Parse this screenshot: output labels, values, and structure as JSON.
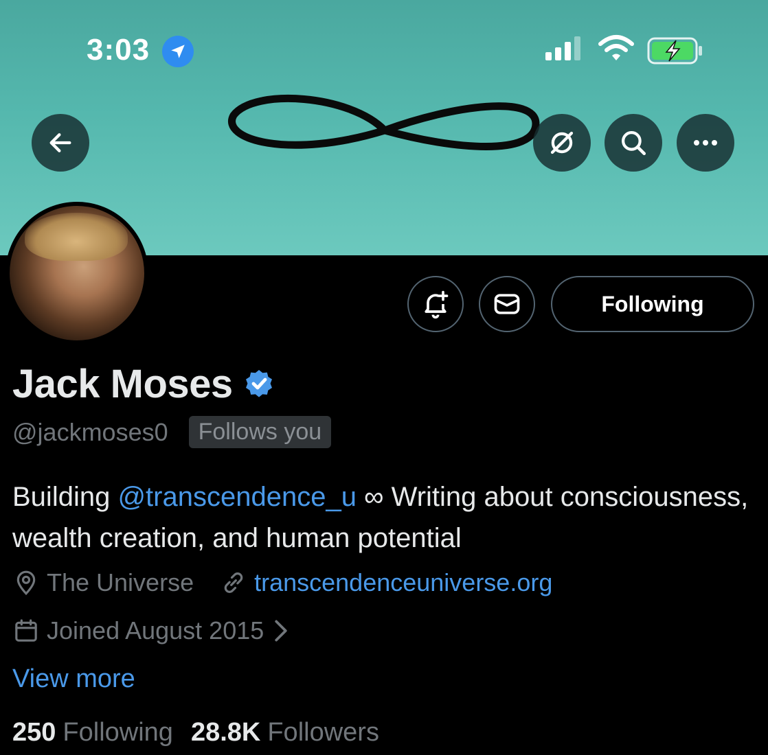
{
  "status_bar": {
    "time": "3:03",
    "icons": [
      "location-arrow-icon",
      "cellular-signal-icon",
      "wifi-icon",
      "battery-charging-icon"
    ]
  },
  "header": {
    "icons": [
      "back-arrow-icon",
      "grok-icon",
      "search-icon",
      "more-icon"
    ],
    "banner_color": "#5ab9ae"
  },
  "profile": {
    "display_name": "Jack Moses",
    "handle": "@jackmoses0",
    "follows_you_badge": "Follows you",
    "bio_prefix": "Building ",
    "bio_mention": "@transcendence_u",
    "bio_suffix": " ∞ Writing about consciousness, wealth creation, and human potential",
    "location": "The Universe",
    "website": "transcendenceuniverse.org",
    "joined": "Joined August 2015",
    "view_more": "View more",
    "following_count": "250",
    "following_label": "Following",
    "followers_count": "28.8K",
    "followers_label": "Followers"
  },
  "actions": {
    "following_button": "Following",
    "icons": [
      "notification-bell-plus-icon",
      "message-icon"
    ]
  },
  "colors": {
    "accent": "#4a99e9",
    "verified": "#4a99e9",
    "muted_text": "#71767b",
    "background": "#000000"
  }
}
